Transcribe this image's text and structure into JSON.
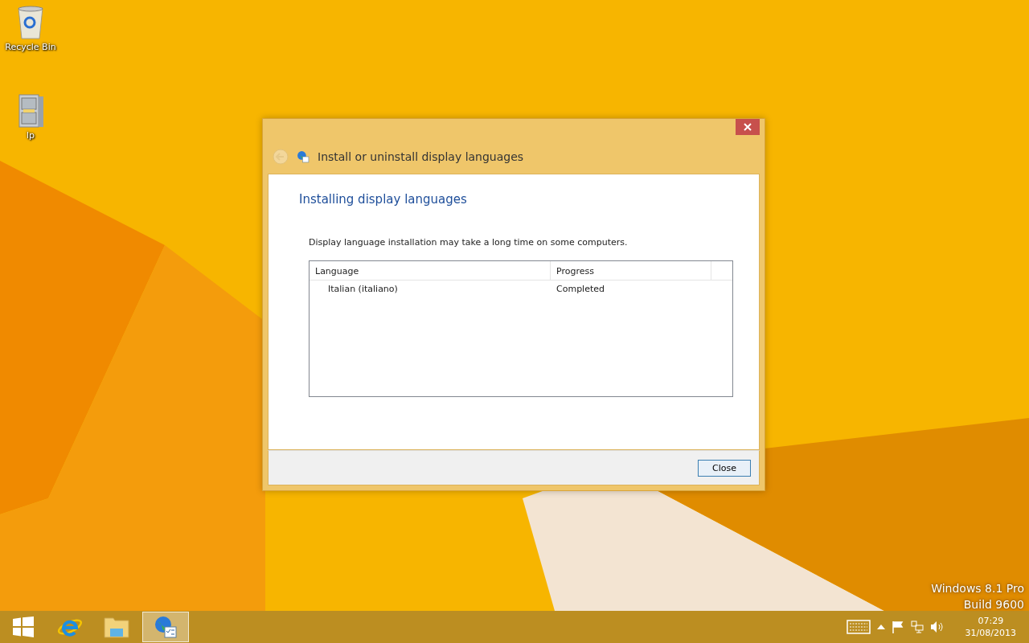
{
  "desktop_icons": [
    {
      "kind": "recycle",
      "label": "Recycle Bin"
    },
    {
      "kind": "cabinet",
      "label": "lp"
    }
  ],
  "dialog": {
    "title": "Install or uninstall display languages",
    "heading": "Installing display languages",
    "description": "Display language installation may take a long time on some computers.",
    "table": {
      "columns": [
        "Language",
        "Progress"
      ],
      "rows": [
        {
          "cells": [
            "Italian (italiano)",
            "Completed"
          ]
        }
      ]
    },
    "buttons": [
      "Close"
    ]
  },
  "os_label": [
    "Windows 8.1 Pro",
    "Build 9600"
  ],
  "taskbar": {
    "apps": [
      {
        "kind": "start",
        "selected": false
      },
      {
        "kind": "ie",
        "selected": false
      },
      {
        "kind": "explorer",
        "selected": false
      },
      {
        "kind": "language",
        "selected": true
      }
    ],
    "time": "07:29",
    "date": "31/08/2013"
  }
}
